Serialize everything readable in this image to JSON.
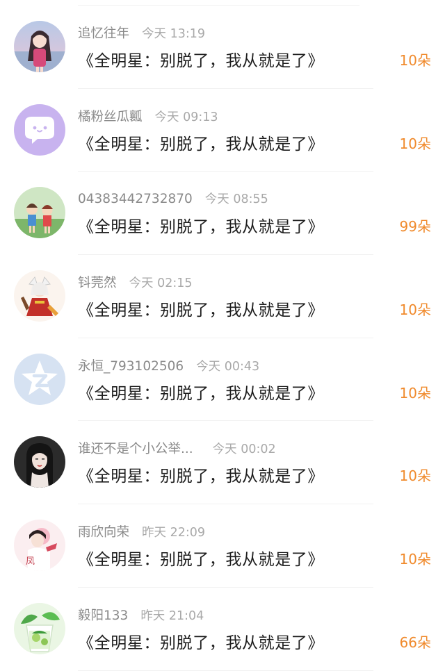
{
  "feed": {
    "items": [
      {
        "username": "追忆往年",
        "time": "今天 13:19",
        "content": "《全明星：别脱了，我从就是了》",
        "flowers": "10朵",
        "avatar_icon": "anime-girl-avatar-icon"
      },
      {
        "username": "橘粉丝瓜瓤",
        "time": "今天 09:13",
        "content": "《全明星：别脱了，我从就是了》",
        "flowers": "10朵",
        "avatar_icon": "chat-bubble-avatar-icon"
      },
      {
        "username": "04383442732870",
        "time": "今天 08:55",
        "content": "《全明星：别脱了，我从就是了》",
        "flowers": "99朵",
        "avatar_icon": "anime-kids-avatar-icon"
      },
      {
        "username": "钭莞然",
        "time": "今天 02:15",
        "content": "《全明星：别脱了，我从就是了》",
        "flowers": "10朵",
        "avatar_icon": "anime-warrior-avatar-icon"
      },
      {
        "username": "永恒_793102506",
        "time": "今天 00:43",
        "content": "《全明星：别脱了，我从就是了》",
        "flowers": "10朵",
        "avatar_icon": "qzone-star-avatar-icon"
      },
      {
        "username": "谁还不是个小公举...",
        "time": "今天 00:02",
        "content": "《全明星：别脱了，我从就是了》",
        "flowers": "10朵",
        "avatar_icon": "dark-hair-girl-avatar-icon"
      },
      {
        "username": "雨欣向荣",
        "time": "昨天 22:09",
        "content": "《全明星：别脱了，我从就是了》",
        "flowers": "10朵",
        "avatar_icon": "illustrated-girl-avatar-icon",
        "avatar_text": "凤"
      },
      {
        "username": "毅阳133",
        "time": "昨天 21:04",
        "content": "《全明星：别脱了，我从就是了》",
        "flowers": "66朵",
        "avatar_icon": "mojito-drink-avatar-icon"
      }
    ]
  },
  "colors": {
    "username": "#8a8a8a",
    "time": "#a9a9a9",
    "content": "#1e1e1e",
    "flowers_accent": "#f08a2c",
    "divider": "#f1f1f1",
    "avatar_purple": "#c8b3ef",
    "avatar_blue": "#d6e2f2"
  }
}
